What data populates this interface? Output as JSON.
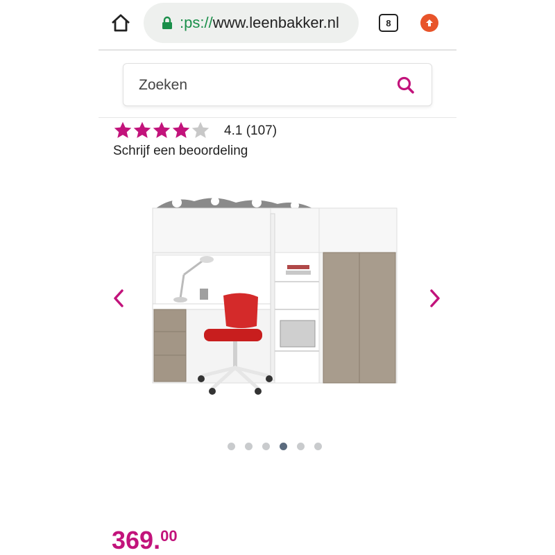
{
  "browser": {
    "url_scheme": ":ps://",
    "url_host": "www.leenbakker.nl",
    "tab_count": "8"
  },
  "search": {
    "placeholder": "Zoeken"
  },
  "rating": {
    "stars_filled": 4,
    "stars_total": 5,
    "summary": "4.1 (107)",
    "write_review_label": "Schrijf een beoordeling"
  },
  "carousel": {
    "slide_count": 6,
    "active_index": 3
  },
  "price": {
    "integer": "369.",
    "decimals": "00"
  },
  "colors": {
    "brand": "#c2137b",
    "star_empty": "#c8c8c8",
    "lock_green": "#1a8f4a",
    "update_orange": "#e8542a"
  }
}
